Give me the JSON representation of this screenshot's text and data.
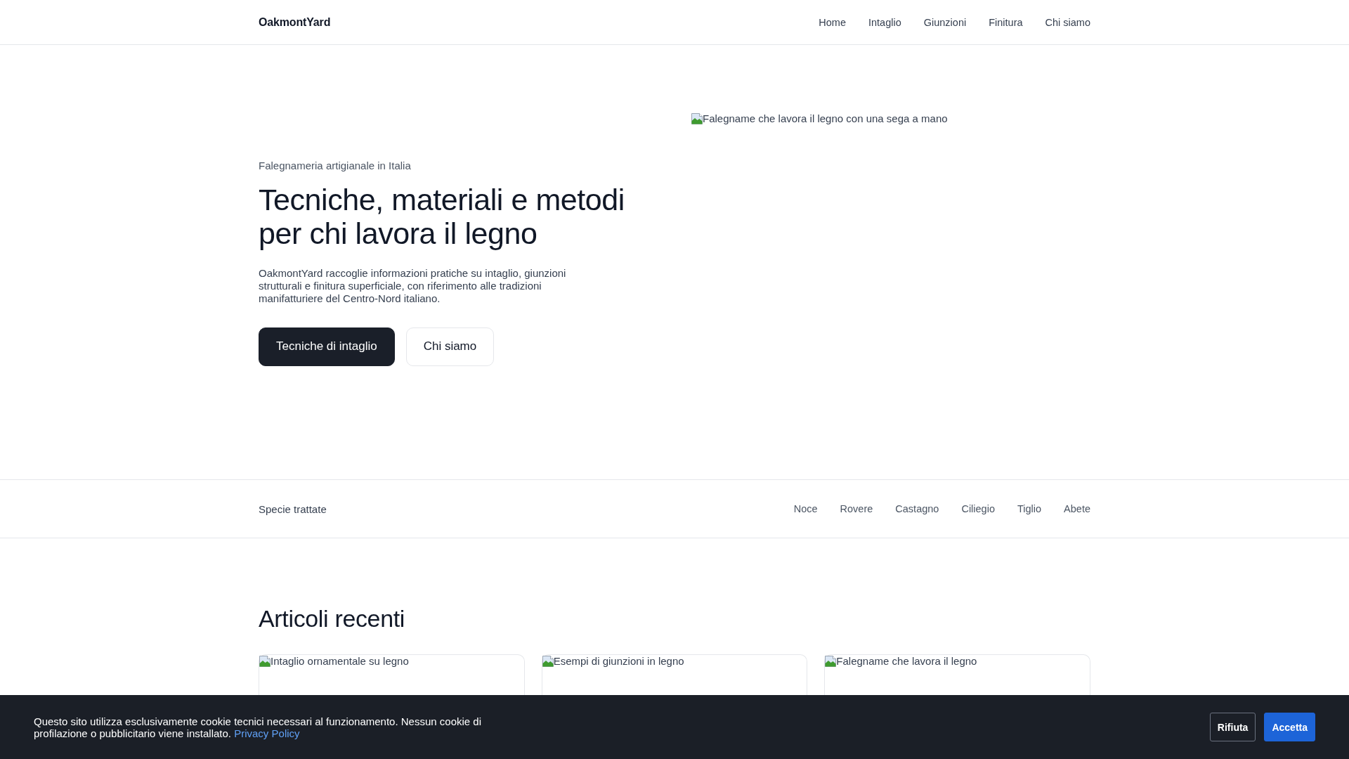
{
  "header": {
    "logo": "OakmontYard",
    "nav": [
      "Home",
      "Intaglio",
      "Giunzioni",
      "Finitura",
      "Chi siamo"
    ]
  },
  "hero": {
    "eyebrow": "Falegnameria artigianale in Italia",
    "title": "Tecniche, materiali e metodi per chi lavora il legno",
    "description": "OakmontYard raccoglie informazioni pratiche su intaglio, giunzioni strutturali e finitura superficiale, con riferimento alle tradizioni manifatturiere del Centro-Nord italiano.",
    "buttons": [
      {
        "label": "Tecniche di intaglio",
        "kind": "primary"
      },
      {
        "label": "Chi siamo",
        "kind": "secondary"
      }
    ],
    "image": {
      "alt": "Falegname che lavora il legno con una sega a mano"
    }
  },
  "species": {
    "label": "Specie trattate",
    "items": [
      "Noce",
      "Rovere",
      "Castagno",
      "Ciliegio",
      "Tiglio",
      "Abete"
    ]
  },
  "articles": {
    "title": "Articoli recenti",
    "cards": [
      {
        "image_alt": "Intaglio ornamentale su legno"
      },
      {
        "image_alt": "Esempi di giunzioni in legno"
      },
      {
        "image_alt": "Falegname che lavora il legno"
      }
    ]
  },
  "cookie_banner": {
    "text": "Questo sito utilizza esclusivamente cookie tecnici necessari al funzionamento. Nessun cookie di profilazione o pubblicitario viene installato.",
    "link": "Privacy Policy",
    "buttons": [
      {
        "label": "Rifiuta",
        "kind": "reject"
      },
      {
        "label": "Accetta",
        "kind": "accept"
      }
    ]
  }
}
